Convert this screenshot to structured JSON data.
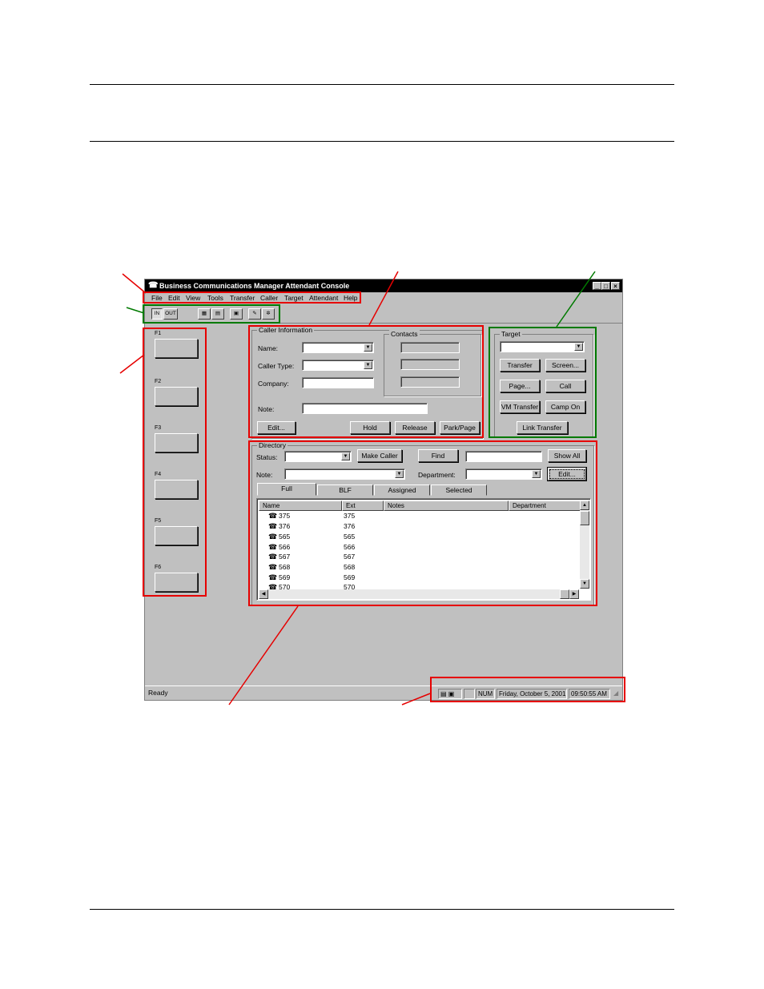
{
  "window": {
    "title": "Business Communications Manager Attendant Console",
    "controls": {
      "minimize": "_",
      "maximize": "□",
      "close": "×"
    }
  },
  "menu": [
    "File",
    "Edit",
    "View",
    "Tools",
    "Transfer",
    "Caller",
    "Target",
    "Attendant",
    "Help"
  ],
  "toolbar": {
    "in_label": "IN",
    "out_label": "OUT"
  },
  "fkeys": [
    "F1",
    "F2",
    "F3",
    "F4",
    "F5",
    "F6"
  ],
  "caller_info": {
    "title": "Caller Information",
    "name_label": "Name:",
    "caller_type_label": "Caller Type:",
    "company_label": "Company:",
    "note_label": "Note:",
    "contacts_title": "Contacts",
    "edit_button": "Edit...",
    "hold_button": "Hold",
    "release_button": "Release",
    "park_page_button": "Park/Page"
  },
  "target": {
    "title": "Target",
    "transfer_button": "Transfer",
    "screen_button": "Screen...",
    "page_button": "Page...",
    "call_button": "Call",
    "vm_transfer_button": "VM Transfer",
    "camp_on_button": "Camp On",
    "link_transfer_button": "Link Transfer"
  },
  "directory": {
    "title": "Directory",
    "status_label": "Status:",
    "make_caller_button": "Make Caller",
    "find_button": "Find",
    "show_all_button": "Show All",
    "note_label": "Note:",
    "department_label": "Department:",
    "edit_button": "Edit...",
    "tabs": [
      "Full",
      "BLF",
      "Assigned",
      "Selected"
    ],
    "columns": [
      "Name",
      "Ext",
      "Notes",
      "Department"
    ],
    "rows": [
      {
        "name": "375",
        "ext": "375"
      },
      {
        "name": "376",
        "ext": "376"
      },
      {
        "name": "565",
        "ext": "565"
      },
      {
        "name": "566",
        "ext": "566"
      },
      {
        "name": "567",
        "ext": "567"
      },
      {
        "name": "568",
        "ext": "568"
      },
      {
        "name": "569",
        "ext": "569"
      },
      {
        "name": "570",
        "ext": "570"
      }
    ]
  },
  "status_bar": {
    "ready": "Ready",
    "num": "NUM",
    "date": "Friday, October 5, 2001",
    "time": "09:50:55 AM"
  },
  "icons": {
    "phone": "☎",
    "dropdown": "▼",
    "scroll_up": "▲",
    "scroll_down": "▼",
    "scroll_left": "◀",
    "scroll_right": "▶"
  },
  "colors": {
    "callout_red": "#e60000",
    "callout_green": "#007a00",
    "titlebar": "#000000",
    "face": "#c0c0c0"
  }
}
